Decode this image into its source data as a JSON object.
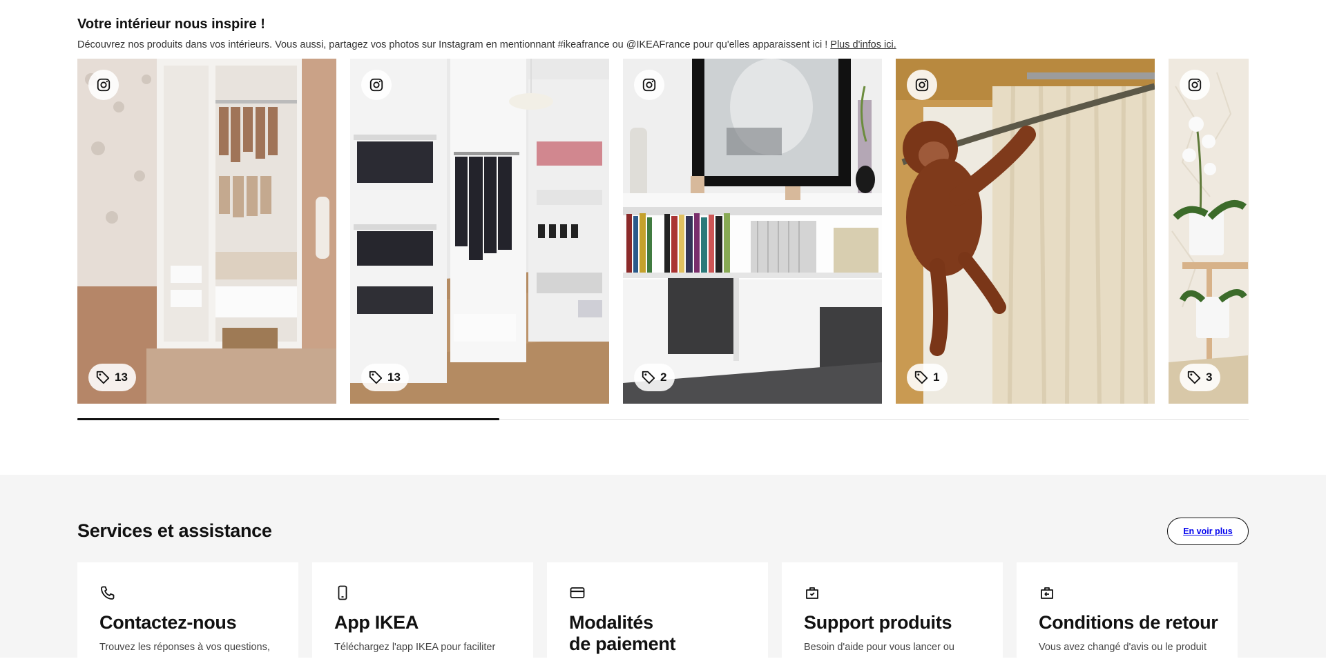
{
  "inspiration": {
    "title": "Votre intérieur nous inspire !",
    "description": "Découvrez nos produits dans vos intérieurs. Vous aussi, partagez vos photos sur Instagram en mentionnant #ikeafrance ou @IKEAFrance pour qu'elles apparaissent ici !",
    "more_link": "Plus d'infos ici.",
    "icons": {
      "instagram": "instagram-icon",
      "tag": "tag-icon"
    },
    "photos": [
      {
        "subject": "baby wardrobe",
        "tag_count": "13"
      },
      {
        "subject": "walk-in closet",
        "tag_count": "13"
      },
      {
        "subject": "shelf with mirror",
        "tag_count": "2"
      },
      {
        "subject": "orangutan toy",
        "tag_count": "1"
      },
      {
        "subject": "orchid plant",
        "tag_count": "3"
      }
    ],
    "scroll_progress": 0.36
  },
  "services": {
    "title": "Services et assistance",
    "see_more": "En voir plus",
    "cards": [
      {
        "icon": "phone-icon",
        "title": "Contactez-nous",
        "text": "Trouvez les réponses à vos questions,"
      },
      {
        "icon": "mobile-phone-icon",
        "title": "App IKEA",
        "text": "Téléchargez l'app IKEA pour faciliter"
      },
      {
        "icon": "credit-card-icon",
        "title_line1": "Modalités",
        "title_line2": "de paiement",
        "text": ""
      },
      {
        "icon": "support-box-icon",
        "title": "Support produits",
        "text": "Besoin d'aide pour vous lancer ou"
      },
      {
        "icon": "return-icon",
        "title": "Conditions de retour",
        "text": "Vous avez changé d'avis ou le produit"
      }
    ]
  }
}
